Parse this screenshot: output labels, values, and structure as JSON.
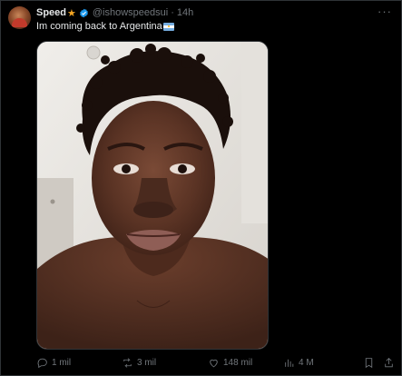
{
  "author": {
    "name": "Speed",
    "badge_icon": "star-icon",
    "verified_icon": "verified-badge-icon",
    "handle": "@ishowspeedsui",
    "separator": "·",
    "time": "14h"
  },
  "tweet": {
    "text": "Im coming back to Argentina",
    "emoji": "argentina-flag-icon"
  },
  "actions": {
    "replies": "1 mil",
    "retweets": "3 mil",
    "likes": "148 mil",
    "views": "4 M"
  },
  "colors": {
    "background": "#000000",
    "text": "#e7e9ea",
    "muted": "#71767b",
    "verified": "#1d9bf0",
    "star": "#f5a623"
  }
}
